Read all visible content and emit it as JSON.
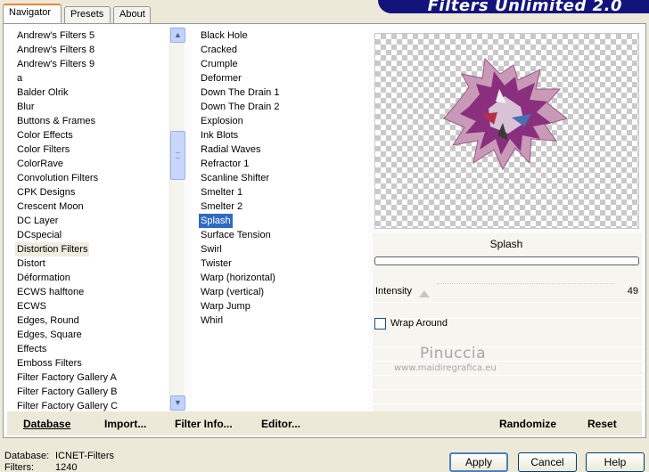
{
  "banner": {
    "title": "Filters Unlimited 2.0"
  },
  "tabs": [
    {
      "label": "Navigator"
    },
    {
      "label": "Presets"
    },
    {
      "label": "About"
    }
  ],
  "categories": [
    "Andrew's Filters 5",
    "Andrew's Filters 8",
    "Andrew's Filters 9",
    "a",
    "Balder Olrik",
    "Blur",
    "Buttons & Frames",
    "Color Effects",
    "Color Filters",
    "ColorRave",
    "Convolution Filters",
    "CPK Designs",
    "Crescent Moon",
    "DC Layer",
    "DCspecial",
    "Distortion Filters",
    "Distort",
    "Déformation",
    "ECWS halftone",
    "ECWS",
    "Edges, Round",
    "Edges, Square",
    "Effects",
    "Emboss Filters",
    "Filter Factory Gallery A",
    "Filter Factory Gallery B",
    "Filter Factory Gallery C"
  ],
  "selected_category": "Distortion Filters",
  "filters": [
    "Black Hole",
    "Cracked",
    "Crumple",
    "Deformer",
    "Down The Drain 1",
    "Down The Drain 2",
    "Explosion",
    "Ink Blots",
    "Radial Waves",
    "Refractor 1",
    "Scanline Shifter",
    "Smelter 1",
    "Smelter 2",
    "Splash",
    "Surface Tension",
    "Swirl",
    "Twister",
    "Warp (horizontal)",
    "Warp (vertical)",
    "Warp Jump",
    "Whirl"
  ],
  "selected_filter": "Splash",
  "right": {
    "filter_name": "Splash",
    "intensity_label": "Intensity",
    "intensity_value": "49",
    "intensity_fraction": 0.19,
    "wrap_label": "Wrap Around",
    "wrap_checked": false
  },
  "watermark": {
    "line1": "Pinuccia",
    "line2": "www.maidiregrafica.eu"
  },
  "bottom": {
    "database_label": "Database",
    "import_label": "Import...",
    "filter_info_label": "Filter Info...",
    "editor_label": "Editor...",
    "randomize_label": "Randomize",
    "reset_label": "Reset"
  },
  "status": {
    "database_key": "Database:",
    "database_value": "ICNET-Filters",
    "filters_key": "Filters:",
    "filters_value": "1240"
  },
  "buttons": {
    "apply": "Apply",
    "cancel": "Cancel",
    "help": "Help"
  },
  "colors": {
    "selection": "#316ac5",
    "tab_accent": "#e68b2c",
    "banner": "#13147b"
  }
}
